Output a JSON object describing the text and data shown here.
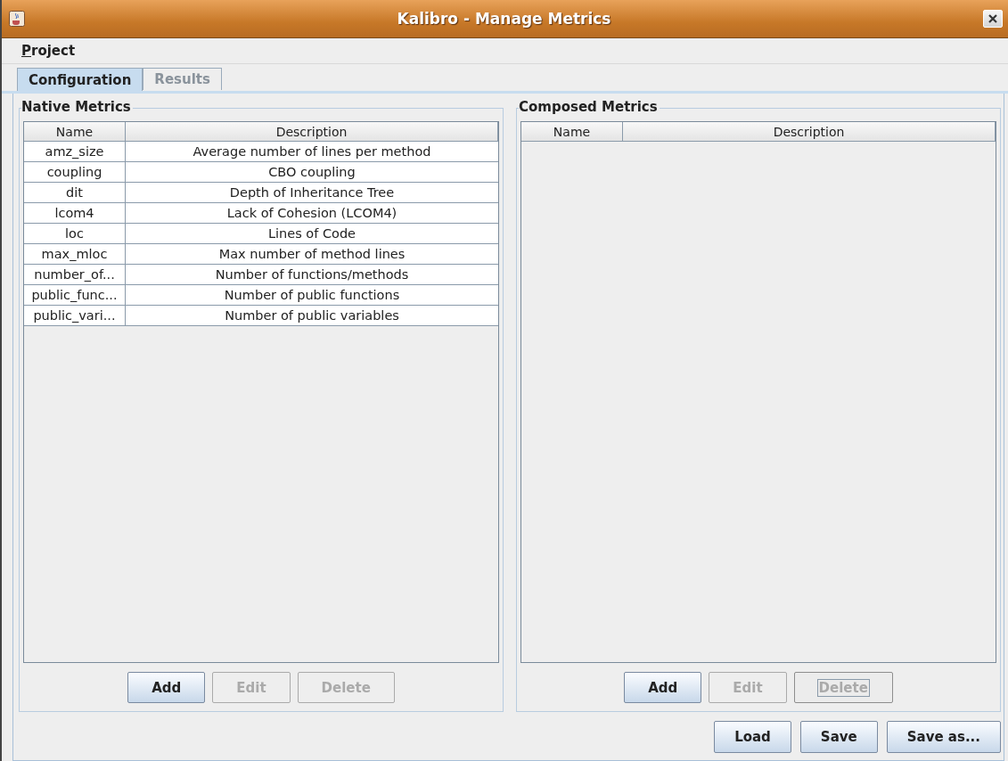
{
  "window": {
    "title": "Kalibro - Manage Metrics"
  },
  "menu": [
    {
      "label": "Project"
    }
  ],
  "tabs": [
    {
      "label": "Configuration",
      "selected": true
    },
    {
      "label": "Results",
      "selected": false
    }
  ],
  "panels": [
    {
      "title": "Native Metrics",
      "columns": [
        "Name",
        "Description"
      ],
      "rows": [
        {
          "name": "amz_size",
          "description": "Average number of lines per method"
        },
        {
          "name": "coupling",
          "description": "CBO coupling"
        },
        {
          "name": "dit",
          "description": "Depth of Inheritance Tree"
        },
        {
          "name": "lcom4",
          "description": "Lack of Cohesion (LCOM4)"
        },
        {
          "name": "loc",
          "description": "Lines of Code"
        },
        {
          "name": "max_mloc",
          "description": "Max number of method lines"
        },
        {
          "name": "number_of...",
          "description": "Number of functions/methods"
        },
        {
          "name": "public_func...",
          "description": "Number of public functions"
        },
        {
          "name": "public_vari...",
          "description": "Number of public variables"
        }
      ],
      "buttons": [
        {
          "label": "Add",
          "disabled": false,
          "focused": false
        },
        {
          "label": "Edit",
          "disabled": true,
          "focused": false
        },
        {
          "label": "Delete",
          "disabled": true,
          "focused": false
        }
      ]
    },
    {
      "title": "Composed Metrics",
      "columns": [
        "Name",
        "Description"
      ],
      "buttons": [
        {
          "label": "Add",
          "disabled": false,
          "focused": false
        },
        {
          "label": "Edit",
          "disabled": true,
          "focused": false
        },
        {
          "label": "Delete",
          "disabled": true,
          "focused": true
        }
      ]
    }
  ],
  "footer_buttons": [
    {
      "label": "Load",
      "disabled": false
    },
    {
      "label": "Save",
      "disabled": false
    },
    {
      "label": "Save as...",
      "disabled": false
    }
  ]
}
